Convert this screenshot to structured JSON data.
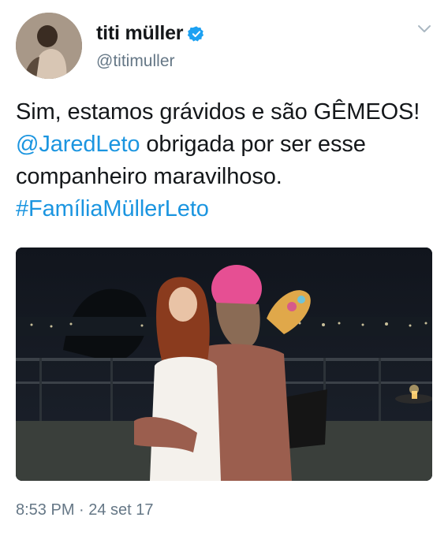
{
  "author": {
    "display_name": "titi müller",
    "handle": "@titimuller",
    "verified": true,
    "verified_color": "#1da1f2"
  },
  "tweet": {
    "text_parts": [
      {
        "text": "Sim, estamos grávidos e são GÊMEOS! ",
        "link": false
      },
      {
        "text": "@JaredLeto",
        "link": true
      },
      {
        "text": " obrigada por ser esse companheiro maravilhoso. ",
        "link": false
      },
      {
        "text": "#FamíliaMüllerLeto",
        "link": true
      }
    ],
    "link_color": "#1b95e0"
  },
  "media": {
    "icon": "photo"
  },
  "meta": {
    "timestamp": "8:53 PM · 24 set 17"
  },
  "icons": {
    "menu": "chevron-down-icon",
    "verified": "verified-badge-icon"
  }
}
